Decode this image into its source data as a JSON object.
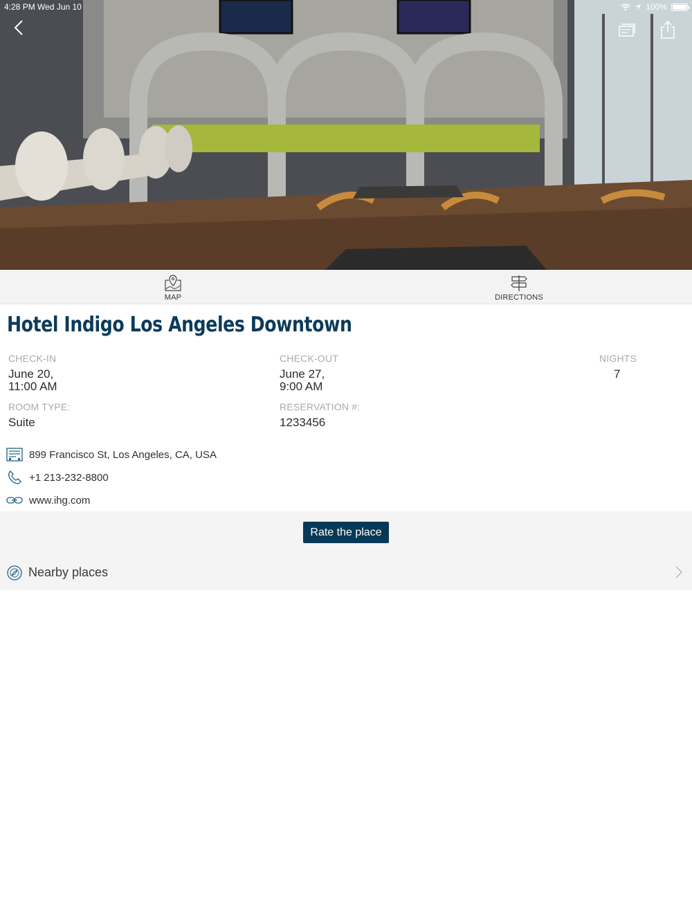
{
  "status_bar": {
    "time_date": "4:28 PM   Wed Jun 10",
    "battery": "100%"
  },
  "hero": {
    "image_name": "hotel-restaurant-photo"
  },
  "actions": [
    {
      "label": "MAP",
      "icon": "map-pin-icon"
    },
    {
      "label": "DIRECTIONS",
      "icon": "signpost-icon"
    }
  ],
  "hotel": {
    "name": "Hotel Indigo Los Angeles Downtown",
    "check_in": {
      "label": "CHECK-IN",
      "date": "June 20,",
      "time": "11:00 AM"
    },
    "check_out": {
      "label": "CHECK-OUT",
      "date": "June 27,",
      "time": "9:00 AM"
    },
    "nights": {
      "label": "NIGHTS",
      "value": "7"
    },
    "room_type": {
      "label": "ROOM TYPE:",
      "value": "Suite"
    },
    "reservation": {
      "label": "RESERVATION #:",
      "value": "1233456"
    },
    "address": "899 Francisco St, Los Angeles, CA, USA",
    "phone": "+1 213-232-8800",
    "website": "www.ihg.com"
  },
  "rate_button": "Rate the place",
  "nearby": {
    "label": "Nearby places"
  },
  "colors": {
    "brand": "#0c3b5b",
    "button": "#083a58",
    "panel": "#f4f4f4",
    "muted": "#a9a9a9"
  }
}
